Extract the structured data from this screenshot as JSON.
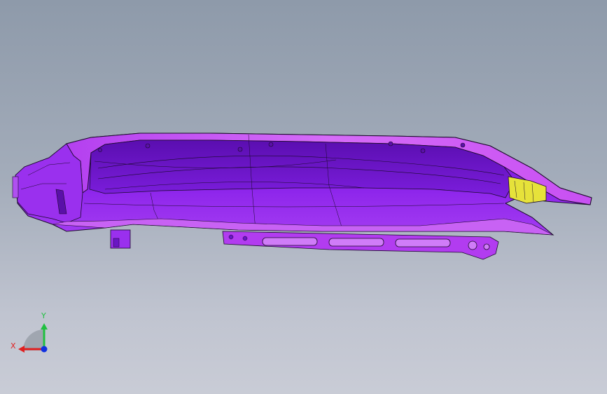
{
  "viewport": {
    "background_top": "#8e9aaa",
    "background_bottom": "#c9ccd6"
  },
  "model": {
    "body_color": "#8a1ee6",
    "highlight_color": "#c64bf0",
    "edge_color": "#1a0a2a",
    "bracket_color": "#e6e23a"
  },
  "triad": {
    "x_label": "X",
    "y_label": "Y",
    "x_color": "#e02020",
    "y_color": "#20c040",
    "z_color": "#1030e0"
  }
}
